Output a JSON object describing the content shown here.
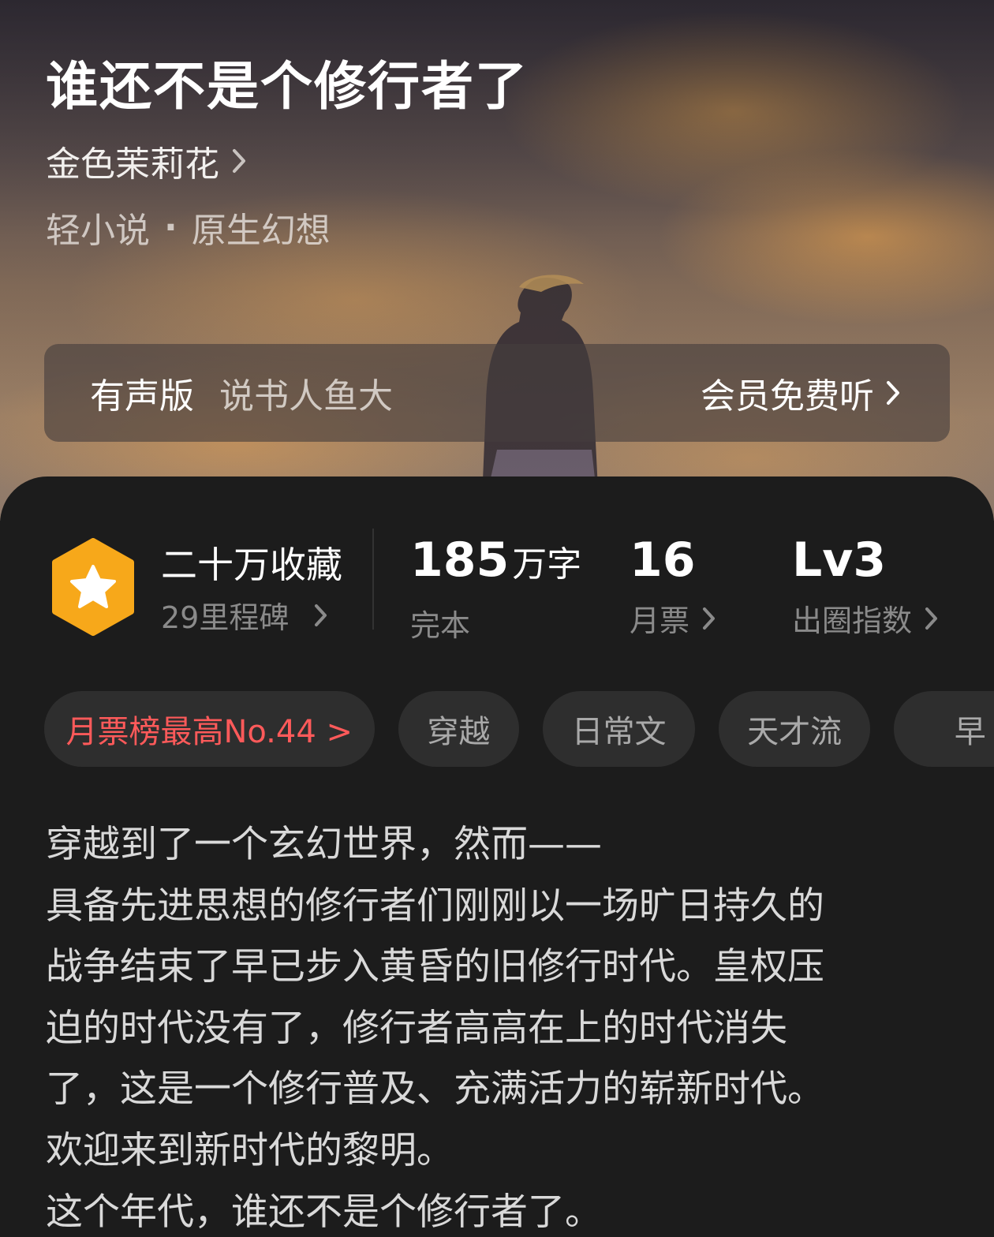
{
  "book": {
    "title": "谁还不是个修行者了",
    "author": "金色茉莉花",
    "category": "轻小说",
    "separator": "·",
    "subcategory": "原生幻想"
  },
  "audio": {
    "label": "有声版",
    "narrator": "说书人鱼大",
    "cta": "会员免费听"
  },
  "stats": {
    "milestone_title": "二十万收藏",
    "milestone_sub": "29里程碑",
    "words_value": "185",
    "words_unit": "万字",
    "words_label": "完本",
    "tickets_value": "16",
    "tickets_label": "月票",
    "level_value": "Lv3",
    "level_label": "出圈指数"
  },
  "tags": {
    "rank": "月票榜最高No.44 >",
    "items": [
      "穿越",
      "日常文",
      "天才流",
      "早"
    ]
  },
  "synopsis": {
    "lines": [
      "穿越到了一个玄幻世界，然而——",
      "具备先进思想的修行者们刚刚以一场旷日持久的",
      "战争结束了早已步入黄昏的旧修行时代。皇权压",
      "迫的时代没有了，修行者高高在上的时代消失",
      "了，这是一个修行普及、充满活力的崭新时代。",
      "欢迎来到新时代的黎明。",
      "这个年代，谁还不是个修行者了。"
    ]
  },
  "colors": {
    "background": "#1c1c1c",
    "tag_bg": "#2e2e2e",
    "rank_red": "#ff5a5a",
    "badge_orange": "#f7a81a",
    "muted_text": "#8a8a8a"
  },
  "icons": {
    "author_chevron": "chevron-right-icon",
    "badge": "star-hexagon-badge-icon"
  }
}
